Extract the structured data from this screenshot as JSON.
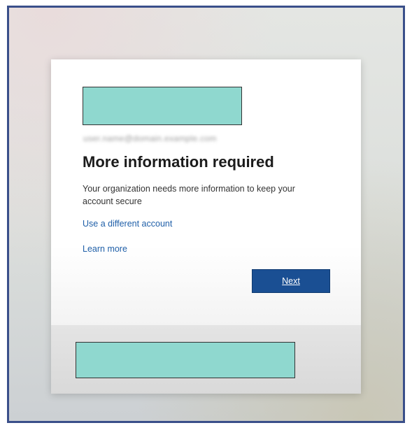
{
  "signin": {
    "email": "user.name@domain.example.com",
    "title": "More information required",
    "description": "Your organization needs more information to keep your account secure",
    "links": {
      "different_account": "Use a different account",
      "learn_more": "Learn more"
    },
    "next_label": "Next"
  },
  "colors": {
    "accent": "#1a4f93",
    "link": "#1f5fa8",
    "redaction": "#8fd8cf",
    "frame_border": "#3a4f8a"
  }
}
